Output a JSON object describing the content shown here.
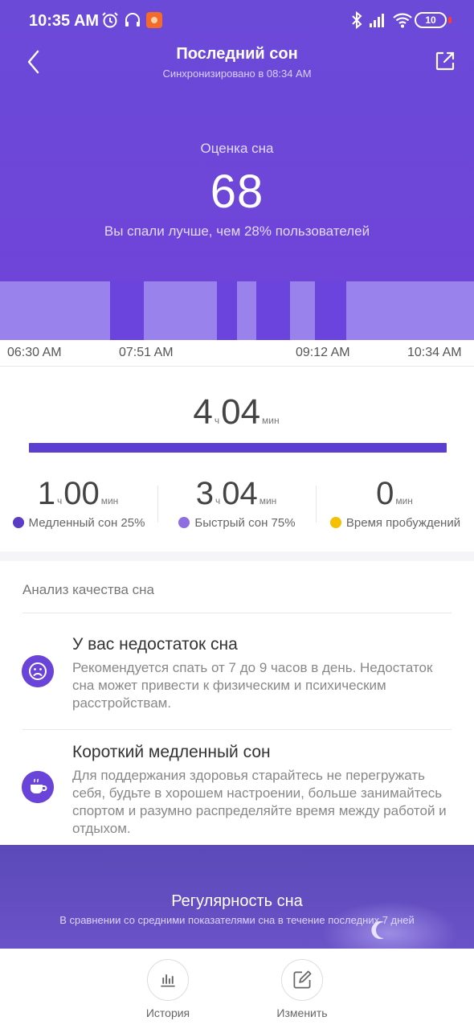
{
  "status_bar": {
    "time": "10:35 AM",
    "battery": "10",
    "icons": [
      "alarm-icon",
      "headphones-icon",
      "app-notification-icon",
      "bluetooth-icon",
      "signal-icon",
      "wifi-icon",
      "battery-icon"
    ]
  },
  "header": {
    "title": "Последний сон",
    "subtitle": "Синхронизировано в 08:34 AM",
    "back_icon": "chevron-left-icon",
    "share_icon": "share-icon"
  },
  "score": {
    "label": "Оценка сна",
    "value": "68",
    "note": "Вы спали лучше, чем 28% пользователей"
  },
  "timeline": {
    "ticks": [
      "06:30 AM",
      "07:51 AM",
      "09:12 AM",
      "10:34 AM"
    ]
  },
  "total": {
    "hours": "4",
    "hours_unit": "ч",
    "minutes": "04",
    "minutes_unit": "мин"
  },
  "stats": [
    {
      "hours": "1",
      "hours_unit": "ч",
      "minutes": "00",
      "minutes_unit": "мин",
      "label": "Медленный сон 25%",
      "color": "#5b3cc4"
    },
    {
      "hours": "3",
      "hours_unit": "ч",
      "minutes": "04",
      "minutes_unit": "мин",
      "label": "Быстрый сон 75%",
      "color": "#8e6ee0"
    },
    {
      "hours": "",
      "hours_unit": "",
      "minutes": "0",
      "minutes_unit": "мин",
      "label": "Время пробуждений",
      "color": "#f5c000"
    }
  ],
  "analysis": {
    "title": "Анализ качества сна",
    "items": [
      {
        "icon": "sad-face-icon",
        "title": "У вас недостаток сна",
        "text": "Рекомендуется спать от 7 до 9 часов в день. Недостаток сна может привести к физическим и психическим расстройствам."
      },
      {
        "icon": "coffee-cup-icon",
        "title": "Короткий медленный сон",
        "text": "Для поддержания здоровья старайтесь не перегружать себя, будьте в хорошем настроении, больше занимайтесь спортом и разумно распределяйте время между работой и отдыхом."
      }
    ]
  },
  "regularity": {
    "title": "Регулярность сна",
    "subtitle": "В сравнении со средними показателями сна в течение последних 7 дней"
  },
  "bottom_bar": {
    "history_label": "История",
    "edit_label": "Изменить"
  },
  "colors": {
    "accent": "#6a44d8",
    "deep_sleep": "#6a44dc",
    "light_sleep": "#9a82ec"
  }
}
